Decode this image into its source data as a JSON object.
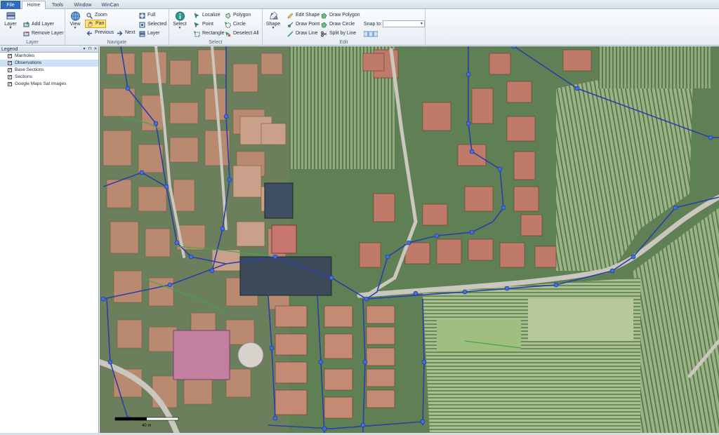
{
  "tabs": {
    "file": "File",
    "home": "Home",
    "tools": "Tools",
    "window": "Window",
    "wincan": "WinCan"
  },
  "ribbon": {
    "layer_group": {
      "label": "Layer",
      "layer_button": "Layer",
      "add_layer": "Add Layer",
      "remove_layer": "Remove Layer"
    },
    "navigate_group": {
      "label": "Navigate",
      "view_button": "View",
      "zoom": "Zoom",
      "pan": "Pan",
      "previous": "Previous",
      "next": "Next",
      "full": "Full",
      "selected": "Selected",
      "layer": "Layer"
    },
    "select_group": {
      "label": "Select",
      "select_button": "Select",
      "localize": "Localize",
      "point": "Point",
      "rectangle": "Rectangle",
      "polygon": "Polygon",
      "circle": "Circle",
      "deselect_all": "Deselect All"
    },
    "edit_group": {
      "label": "Edit",
      "shape_button": "Shape",
      "edit_shape": "Edit Shape",
      "draw_point": "Draw Point",
      "draw_line": "Draw Line",
      "draw_polygon": "Draw Polygon",
      "draw_circle": "Draw Circle",
      "split_by_line": "Split by Line",
      "snap_to": "Snap to:"
    }
  },
  "legend": {
    "title": "Legend",
    "items": [
      {
        "label": "Manholes",
        "checked": true
      },
      {
        "label": "Observations",
        "checked": true
      },
      {
        "label": "Base Sections",
        "checked": true
      },
      {
        "label": "Sections",
        "checked": true
      },
      {
        "label": "Google Maps Sat Images",
        "checked": true
      }
    ]
  },
  "map": {
    "scale_label": "40 m"
  },
  "colors": {
    "accent": "#2f6cc0",
    "pan_highlight": "#ffe27a",
    "network_line": "#2a3fa8",
    "manhole": "#3f6fe0",
    "selection": "#cfe1f7"
  }
}
